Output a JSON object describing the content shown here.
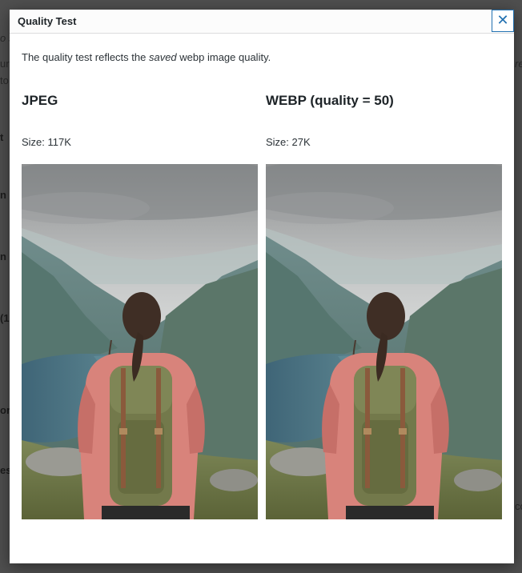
{
  "dialog": {
    "title": "Quality Test",
    "close_icon": "close-icon",
    "intro_before": "The quality test reflects the ",
    "intro_em": "saved",
    "intro_after": " webp image quality."
  },
  "columns": [
    {
      "heading": "JPEG",
      "size_text": "Size: 117K",
      "image_alt": "hiker-with-backpack-overlooking-mountain-lake"
    },
    {
      "heading": "WEBP (quality = 50)",
      "size_text": "Size: 27K",
      "image_alt": "hiker-with-backpack-overlooking-mountain-lake"
    }
  ],
  "background_fragments": [
    "o s",
    "ur",
    "to",
    "t",
    "n",
    "n",
    "(1",
    "or",
    "es",
    "re",
    "cc"
  ]
}
